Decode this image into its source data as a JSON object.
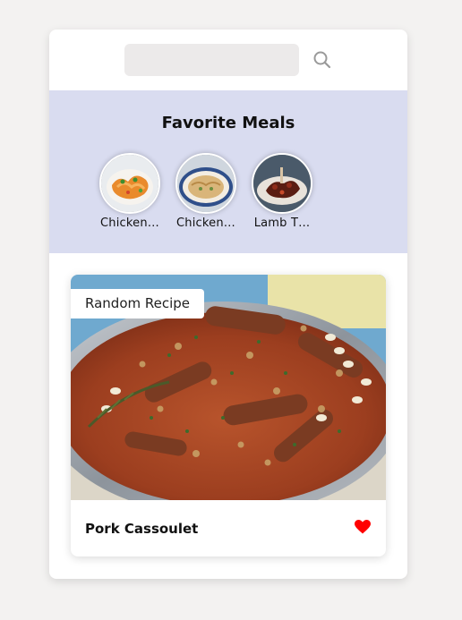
{
  "search": {
    "value": "",
    "placeholder": "",
    "icon": "search-icon"
  },
  "favorites": {
    "title": "Favorite Meals",
    "items": [
      {
        "name": "Chicken…"
      },
      {
        "name": "Chicken…"
      },
      {
        "name": "Lamb T…"
      }
    ]
  },
  "random_meal": {
    "tag": "Random Recipe",
    "title": "Pork Cassoulet",
    "favorite_icon": "heart-icon",
    "favorited": true
  },
  "colors": {
    "background": "#f3f2f1",
    "card": "#ffffff",
    "favorites_band": "#d9dcf0",
    "search_field": "#eceaea",
    "heart": "#ff0000"
  }
}
